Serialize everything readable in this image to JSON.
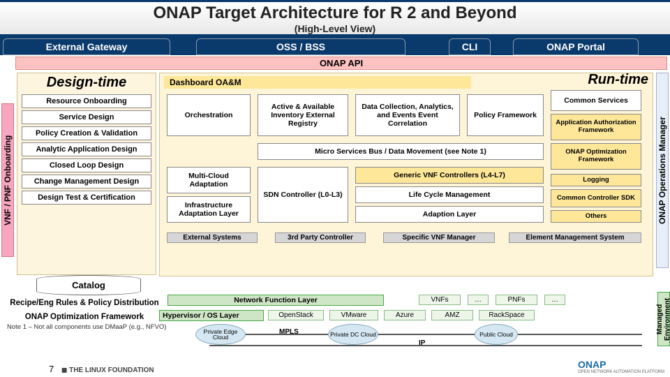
{
  "title": {
    "main": "ONAP Target Architecture for R 2 and Beyond",
    "sub": "(High-Level View)"
  },
  "top_tabs": {
    "gateway": "External Gateway",
    "oss": "OSS / BSS",
    "cli": "CLI",
    "portal": "ONAP Portal"
  },
  "api_bar": "ONAP API",
  "side": {
    "vnf": "VNF / PNF Onboarding",
    "ops": "ONAP Operations Manager",
    "managed": "Managed Environment"
  },
  "design": {
    "title": "Design-time",
    "items": [
      "Resource Onboarding",
      "Service  Design",
      "Policy Creation & Validation",
      "Analytic Application Design",
      "Closed Loop Design",
      "Change Management Design",
      "Design Test & Certification"
    ],
    "catalog": "Catalog"
  },
  "runtime": {
    "dash": "Dashboard OA&M",
    "title": "Run-time",
    "cells": {
      "orchestration": "Orchestration",
      "active": "Active & Available Inventory External Registry",
      "data_collect": "Data Collection, Analytics, and Events Event Correlation",
      "policy": "Policy Framework",
      "common_services": "Common Services",
      "app_auth": "Application Authorization Framework",
      "onap_opt": "ONAP Optimization Framework",
      "microbus": "Micro Services Bus / Data Movement (see Note 1)",
      "multi_cloud": "Multi-Cloud Adaptation",
      "infra": "Infrastructure Adaptation Layer",
      "sdn": "SDN Controller (L0-L3)",
      "generic_vnf": "Generic VNF Controllers (L4-L7)",
      "lifecycle": "Life Cycle Management",
      "adaption": "Adaption Layer",
      "logging": "Logging",
      "ccsdk": "Common Controller SDK",
      "others": "Others"
    }
  },
  "left_texts": {
    "recipe": "Recipe/Eng Rules & Policy Distribution",
    "onap_opt_fw": "ONAP Optimization Framework"
  },
  "external_row": {
    "ext_sys": "External Systems",
    "third": "3rd Party Controller",
    "specific": "Specific VNF Manager",
    "ems": "Element Management System"
  },
  "env": {
    "nfl": "Network Function Layer",
    "vnfs": "VNFs",
    "dots1": "…",
    "pnfs": "PNFs",
    "dots2": "…",
    "hyp": "Hypervisor / OS Layer",
    "openstack": "OpenStack",
    "vmware": "VMware",
    "azure": "Azure",
    "amz": "AMZ",
    "rackspace": "RackSpace",
    "mpls": "MPLS",
    "ip": "IP",
    "priv_edge": "Private Edge Cloud",
    "priv_dc": "Private DC Cloud",
    "pub_cloud": "Public Cloud"
  },
  "note1": "Note 1 – Not all components use DMaaP (e.g., NFVO)",
  "footer": {
    "page": "7",
    "linux": "THE LINUX FOUNDATION",
    "onap": "ONAP",
    "onap_sub": "OPEN NETWORK AUTOMATION PLATFORM"
  }
}
